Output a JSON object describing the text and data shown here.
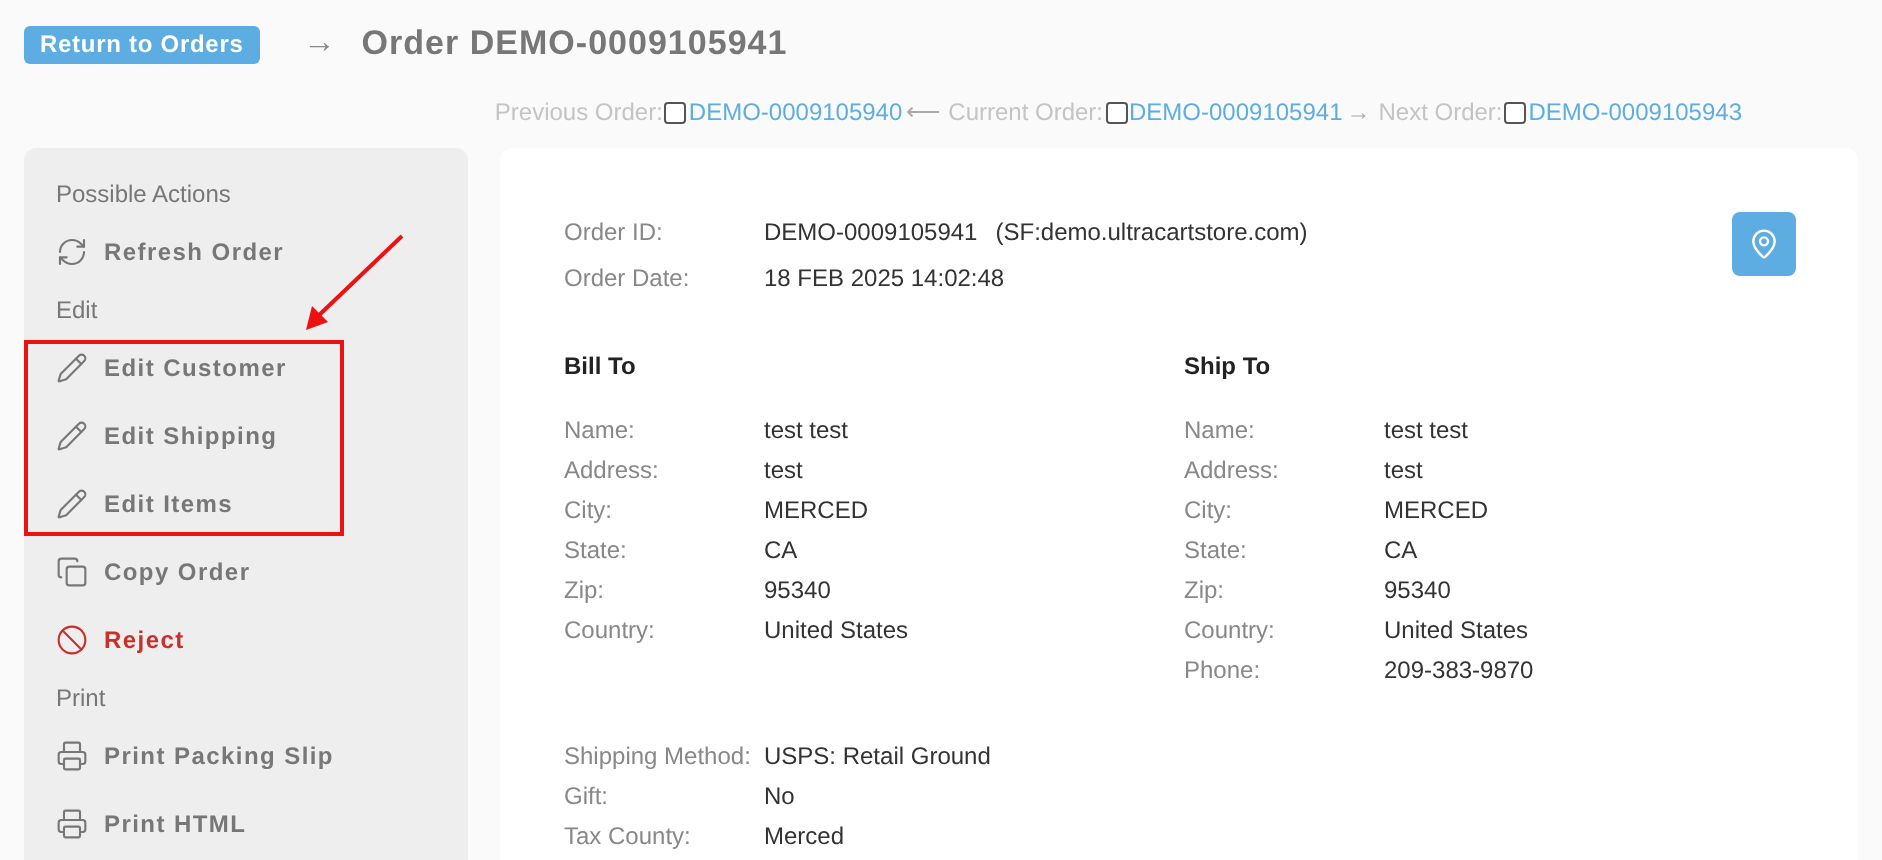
{
  "header": {
    "back_button": "Return to Orders",
    "arrow": "→",
    "title": "Order DEMO-0009105941"
  },
  "order_nav": [
    {
      "label": "Previous Order:",
      "checked": false,
      "link": "DEMO-0009105940",
      "separator": "⟵"
    },
    {
      "label": "Current Order:",
      "checked": false,
      "link": "DEMO-0009105941",
      "separator": "→"
    },
    {
      "label": "Next Order:",
      "checked": false,
      "link": "DEMO-0009105943"
    }
  ],
  "sidebar": {
    "items": [
      {
        "kind": "heading",
        "label": "Possible Actions"
      },
      {
        "kind": "refresh",
        "label": "Refresh Order"
      },
      {
        "kind": "heading",
        "label": "Edit"
      },
      {
        "kind": "edit",
        "label": "Edit Customer"
      },
      {
        "kind": "edit",
        "label": "Edit Shipping"
      },
      {
        "kind": "edit",
        "label": "Edit Items"
      },
      {
        "kind": "copy",
        "label": "Copy Order"
      },
      {
        "kind": "reject",
        "label": "Reject"
      },
      {
        "kind": "heading",
        "label": "Print"
      },
      {
        "kind": "print",
        "label": "Print Packing Slip"
      },
      {
        "kind": "print",
        "label": "Print HTML"
      }
    ]
  },
  "order": {
    "fields": [
      {
        "label": "Order ID:",
        "value": "DEMO-0009105941",
        "note": "(SF:demo.ultracartstore.com)"
      },
      {
        "label": "Order Date:",
        "value": "18 FEB 2025 14:02:48"
      }
    ],
    "bill_to": {
      "title": "Bill To",
      "rows": [
        {
          "label": "Name:",
          "value": "test test"
        },
        {
          "label": "Address:",
          "value": "test"
        },
        {
          "label": "City:",
          "value": "MERCED"
        },
        {
          "label": "State:",
          "value": "CA"
        },
        {
          "label": "Zip:",
          "value": "95340"
        },
        {
          "label": "Country:",
          "value": "United States"
        }
      ]
    },
    "ship_to": {
      "title": "Ship To",
      "rows": [
        {
          "label": "Name:",
          "value": "test test"
        },
        {
          "label": "Address:",
          "value": "test"
        },
        {
          "label": "City:",
          "value": "MERCED"
        },
        {
          "label": "State:",
          "value": "CA"
        },
        {
          "label": "Zip:",
          "value": "95340"
        },
        {
          "label": "Country:",
          "value": "United States"
        },
        {
          "label": "Phone:",
          "value": "209-383-9870"
        }
      ]
    },
    "shipping": [
      {
        "label": "Shipping Method:",
        "value": "USPS: Retail Ground"
      },
      {
        "label": "Gift:",
        "value": "No"
      },
      {
        "label": "Tax County:",
        "value": "Merced"
      }
    ]
  }
}
